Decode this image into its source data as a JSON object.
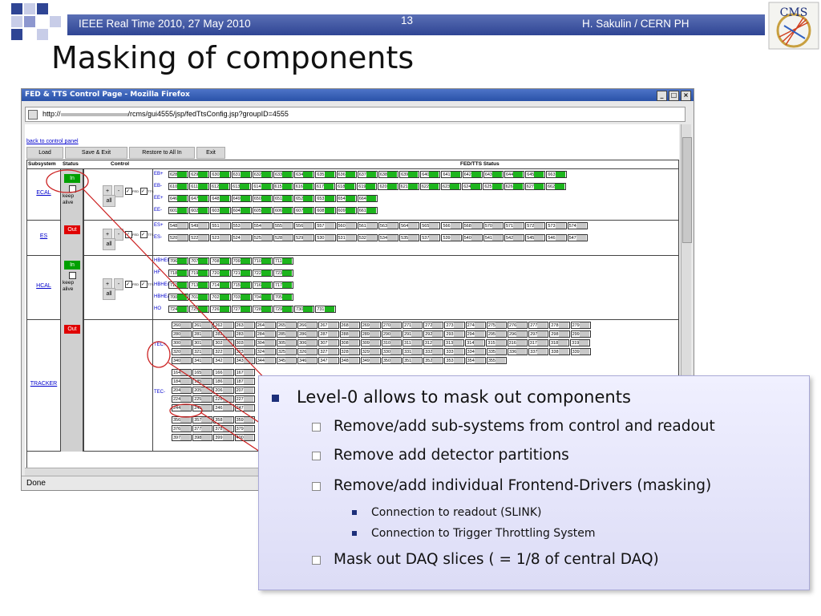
{
  "header": {
    "conference": "IEEE Real Time 2010, 27 May 2010",
    "page_number": "13",
    "author": "H. Sakulin / CERN PH",
    "logo_label": "CMS"
  },
  "slide_title": "Masking of components",
  "browser": {
    "window_title": "FED & TTS Control Page - Mozilla Firefox",
    "url_prefix": "http://",
    "url_path": "/rcms/gui4555/jsp/fedTtsConfig.jsp?groupID=4555",
    "status_text": "Done"
  },
  "page": {
    "back_link": "back to control panel",
    "buttons": [
      "Load",
      "Save & Exit",
      "Restore to All In",
      "Exit"
    ],
    "columns": {
      "subsystem": "Subsystem",
      "status": "Status",
      "control": "Control",
      "fed_tts": "FED/TTS Status"
    },
    "controls": {
      "plus": "+",
      "minus": "-",
      "all": "all",
      "fed": "FED",
      "tts": "TTS",
      "keep_alive": "keep alive"
    },
    "subsystems": [
      {
        "name": "ECAL",
        "status": "In",
        "status_color": "#00a000",
        "partitions": [
          {
            "name": "EB+",
            "feds": [
              "628",
              "629",
              "630",
              "631",
              "632",
              "633",
              "634",
              "635",
              "636",
              "637",
              "638",
              "639",
              "640",
              "641",
              "642",
              "643",
              "644",
              "645",
              "663"
            ]
          },
          {
            "name": "EB-",
            "feds": [
              "610",
              "611",
              "612",
              "613",
              "614",
              "615",
              "616",
              "617",
              "618",
              "619",
              "620",
              "621",
              "622",
              "623",
              "624",
              "625",
              "626",
              "627",
              "662"
            ]
          },
          {
            "name": "EE+",
            "feds": [
              "646",
              "647",
              "648",
              "649",
              "650",
              "651",
              "652",
              "653",
              "654",
              "664"
            ]
          },
          {
            "name": "EE-",
            "feds": [
              "601",
              "602",
              "603",
              "604",
              "605",
              "606",
              "607",
              "608",
              "609",
              "661"
            ]
          }
        ]
      },
      {
        "name": "ES",
        "status": "Out",
        "status_color": "#e00000",
        "partitions": [
          {
            "name": "ES+",
            "feds": [
              "548",
              "549",
              "551",
              "553",
              "554",
              "555",
              "556",
              "557",
              "560",
              "561",
              "563",
              "564",
              "565",
              "566",
              "568",
              "570",
              "571",
              "572",
              "573",
              "574"
            ]
          },
          {
            "name": "ES-",
            "feds": [
              "520",
              "522",
              "523",
              "524",
              "525",
              "528",
              "529",
              "530",
              "531",
              "532",
              "534",
              "535",
              "537",
              "539",
              "540",
              "541",
              "542",
              "545",
              "546",
              "547"
            ]
          }
        ]
      },
      {
        "name": "HCAL",
        "status": "In",
        "status_color": "#00a000",
        "partitions": [
          {
            "name": "HBHEb",
            "feds": [
              "706",
              "707",
              "708",
              "709",
              "710",
              "711"
            ]
          },
          {
            "name": "HF",
            "feds": [
              "718",
              "719",
              "720",
              "721",
              "722",
              "723"
            ]
          },
          {
            "name": "HBHEc",
            "feds": [
              "712",
              "713",
              "714",
              "715",
              "716",
              "717"
            ]
          },
          {
            "name": "HBHEa",
            "feds": [
              "700",
              "701",
              "702",
              "703",
              "704",
              "705"
            ]
          },
          {
            "name": "HO",
            "feds": [
              "724",
              "725",
              "726",
              "727",
              "728",
              "729",
              "730",
              "731"
            ]
          }
        ]
      },
      {
        "name": "TRACKER",
        "status": "Out",
        "status_color": "#e00000",
        "partitions": [
          {
            "name": "TEC+",
            "rows": [
              [
                "260",
                "261",
                "262",
                "263",
                "264",
                "265",
                "266",
                "267",
                "268",
                "269",
                "270",
                "271",
                "272",
                "273",
                "274",
                "275",
                "276",
                "277",
                "278",
                "279"
              ],
              [
                "280",
                "281",
                "282",
                "283",
                "284",
                "285",
                "286",
                "287",
                "288",
                "289",
                "290",
                "291",
                "292",
                "293",
                "294",
                "295",
                "296",
                "297",
                "298",
                "299"
              ],
              [
                "300",
                "301",
                "302",
                "303",
                "304",
                "305",
                "306",
                "307",
                "308",
                "309",
                "310",
                "311",
                "312",
                "313",
                "314",
                "315",
                "316",
                "317",
                "318",
                "319"
              ],
              [
                "320",
                "321",
                "322",
                "323",
                "324",
                "325",
                "326",
                "327",
                "328",
                "329",
                "330",
                "331",
                "332",
                "333",
                "334",
                "335",
                "336",
                "337",
                "338",
                "339"
              ],
              [
                "340",
                "341",
                "342",
                "343",
                "344",
                "345",
                "346",
                "347",
                "348",
                "349",
                "350",
                "351",
                "352",
                "353",
                "354",
                "355"
              ]
            ]
          },
          {
            "name": "TEC-",
            "rows": [
              [
                "164",
                "165",
                "166",
                "167"
              ],
              [
                "184",
                "185",
                "186",
                "187"
              ],
              [
                "204",
                "205",
                "206",
                "207"
              ],
              [
                "224",
                "225",
                "226",
                "227"
              ],
              [
                "244",
                "245",
                "246",
                "247"
              ]
            ]
          },
          {
            "name": "",
            "rows": [
              [
                "356",
                "357",
                "358",
                "359"
              ],
              [
                "376",
                "377",
                "378",
                "379"
              ],
              [
                "397",
                "398",
                "399",
                "400"
              ]
            ]
          }
        ]
      }
    ]
  },
  "callout": {
    "level1": "Level-0 allows to mask out components",
    "items": [
      {
        "text": "Remove/add sub-systems from control and readout",
        "sub": []
      },
      {
        "text": "Remove add detector partitions",
        "sub": []
      },
      {
        "text": "Remove/add individual Frontend-Drivers (masking)",
        "sub": [
          "Connection to readout (SLINK)",
          "Connection to Trigger Throttling System"
        ]
      },
      {
        "text": "Mask out DAQ slices ( = 1/8 of central DAQ)",
        "sub": []
      }
    ]
  },
  "colors": {
    "header_band": "#2f4594",
    "fed_on": "#1db51d",
    "status_in": "#00a000",
    "status_out": "#e00000",
    "callout_line": "#cc2222"
  }
}
